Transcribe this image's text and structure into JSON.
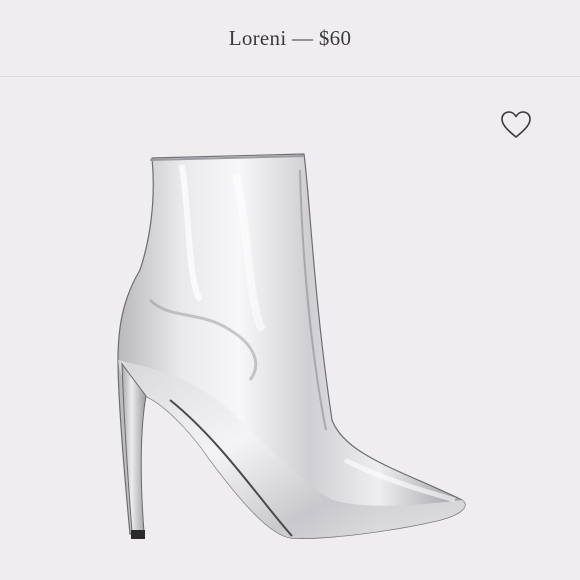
{
  "header": {
    "title": "Loreni — $60"
  },
  "product": {
    "image_alt": "silver-metallic-stiletto-ankle-boot",
    "wishlist_icon": "heart-outline-icon"
  },
  "colors": {
    "background": "#efedf0",
    "title_text": "#3b3b3d",
    "divider": "#dddadd"
  }
}
